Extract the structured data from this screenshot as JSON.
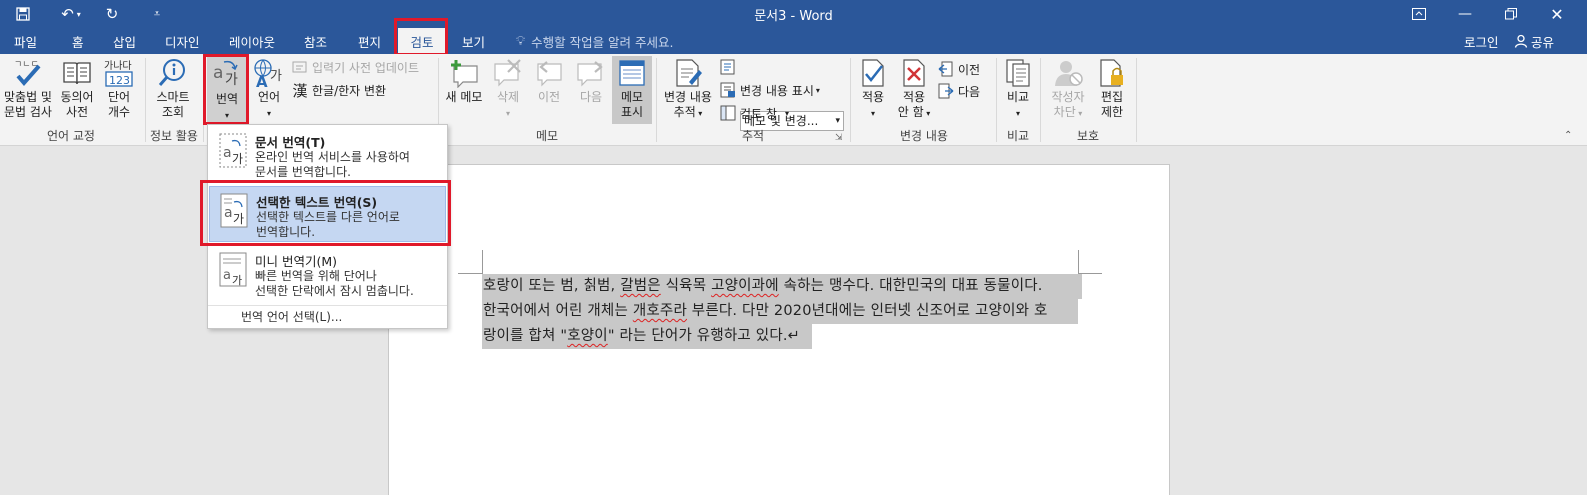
{
  "window": {
    "title": "문서3 - Word"
  },
  "tabs": [
    {
      "label": "파일",
      "key": "file"
    },
    {
      "label": "홈",
      "key": "home"
    },
    {
      "label": "삽입",
      "key": "insert"
    },
    {
      "label": "디자인",
      "key": "design"
    },
    {
      "label": "레이아웃",
      "key": "layout"
    },
    {
      "label": "참조",
      "key": "references"
    },
    {
      "label": "편지",
      "key": "mailings"
    },
    {
      "label": "검토",
      "key": "review"
    },
    {
      "label": "보기",
      "key": "view"
    }
  ],
  "tell_me": "수행할 작업을 알려 주세요.",
  "account": {
    "signin": "로그인",
    "share": "공유"
  },
  "ribbon": {
    "proofing": {
      "spelling": "맞춤법 및 문법 검사",
      "spelling_line1": "맞춤법 및",
      "spelling_line2": "문법 검사",
      "thesaurus_line1": "동의어",
      "thesaurus_line2": "사전",
      "wordcount_line1": "단어",
      "wordcount_line2": "개수",
      "wordcount_icon_text": "가나다",
      "wordcount_icon_num": "123",
      "spell_icon_text": "ㄱㄴㄷ",
      "label": "언어 교정"
    },
    "insights": {
      "smart_line1": "스마트",
      "smart_line2": "조회",
      "label": "정보 활용"
    },
    "language": {
      "translate": "번역",
      "language": "언어",
      "ime_update": "입력기 사전 업데이트",
      "hanja": "한글/한자 변환",
      "hanja_icon": "漢"
    },
    "comments": {
      "new": "새 메모",
      "delete": "삭제",
      "prev": "이전",
      "next": "다음",
      "show_line1": "메모",
      "show_line2": "표시",
      "label": "메모"
    },
    "tracking": {
      "track_line1": "변경 내용",
      "track_line2": "추적",
      "markup_select": "메모 및 변경...",
      "show_markup": "변경 내용 표시",
      "review_pane": "검토 창",
      "label": "추적"
    },
    "changes": {
      "accept": "적용",
      "reject_line1": "적용",
      "reject_line2": "안 함",
      "prev": "이전",
      "next": "다음",
      "label": "변경 내용"
    },
    "compare": {
      "compare": "비교",
      "label": "비교"
    },
    "protect": {
      "block_line1": "작성자",
      "block_line2": "차단",
      "restrict_line1": "편집",
      "restrict_line2": "제한",
      "label": "보호"
    }
  },
  "translate_menu": {
    "items": [
      {
        "title": "문서 번역(T)",
        "desc1": "온라인 번역 서비스를 사용하여",
        "desc2": "문서를 번역합니다."
      },
      {
        "title": "선택한 텍스트 번역(S)",
        "desc1": "선택한 텍스트를 다른 언어로",
        "desc2": "번역합니다."
      },
      {
        "title": "미니 번역기(M)",
        "desc1": "빠른 번역을 위해 단어나",
        "desc2": "선택한 단락에서 잠시 멈춥니다."
      }
    ],
    "footer": "번역 언어 선택(L)..."
  },
  "document": {
    "lines": [
      {
        "a": "호랑이 또는 범, 칡범, ",
        "b": "갈범은",
        "c": " 식육목 ",
        "d": "고양이과에",
        "e": " 속하는 맹수다. 대한민국의 대표 동물이다."
      },
      {
        "a": "한국어에서 어린 개체는 ",
        "b": "개호주라",
        "c": " 부른다. 다만 2020년대에는 인터넷 신조어로 고양이와 호",
        "d": "",
        "e": ""
      },
      {
        "a": "랑이를 합쳐 \"",
        "b": "호양이",
        "c": "\" 라는 단어가 유행하고 있다.↵",
        "d": "",
        "e": ""
      }
    ]
  },
  "colors": {
    "accent": "#2b579a",
    "highlight_box": "#e0192a",
    "menu_hover": "#c5d7f2",
    "selection": "#c8c8c8"
  }
}
